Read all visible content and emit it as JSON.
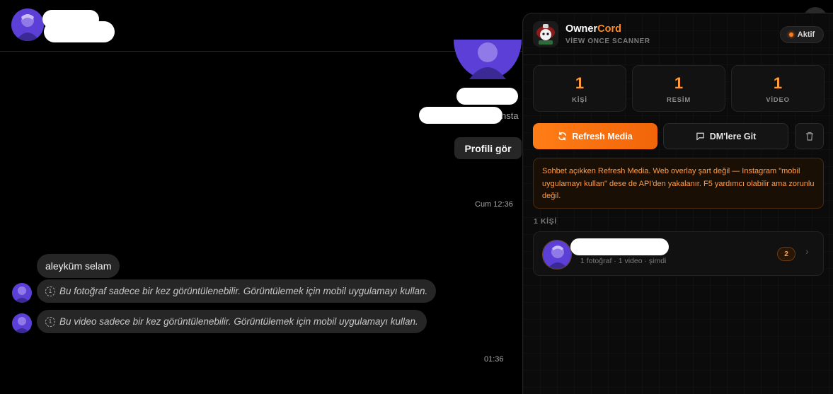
{
  "chat": {
    "profile_button": "Profili gör",
    "insta_fragment": "nsta",
    "timestamp_1": "Cum 12:36",
    "timestamp_2": "01:36",
    "messages": [
      {
        "text": "aleyküm selam"
      },
      {
        "text": "Bu fotoğraf sadece bir kez görüntülenebilir. Görüntülemek için mobil uygulamayı kullan.",
        "icon": "view-once-icon"
      },
      {
        "text": "Bu video sadece bir kez görüntülenebilir. Görüntülemek için mobil uygulamayı kullan.",
        "icon": "view-once-icon"
      }
    ]
  },
  "panel": {
    "brand_part1": "Owner",
    "brand_part2": "Cord",
    "subtitle": "VİEW ONCE SCANNER",
    "status": "Aktif",
    "stats": [
      {
        "value": "1",
        "label": "KİŞİ"
      },
      {
        "value": "1",
        "label": "RESİM"
      },
      {
        "value": "1",
        "label": "VİDEO"
      }
    ],
    "refresh_label": "Refresh Media",
    "dm_label": "DM'lere Git",
    "info": "Sohbet açıkken Refresh Media. Web overlay şart değil — Instagram \"mobil uygulamayı kullan\" dese de API'den yakalanır. F5 yardımcı olabilir ama zorunlu değil.",
    "section_label": "1 KİŞİ",
    "person": {
      "meta": "1 fotoğraf · 1 video · şimdi",
      "count": "2"
    }
  },
  "colors": {
    "accent": "#ff7d16",
    "panel_bg": "#0b0b0b",
    "bubble_bg": "#262626",
    "warning_text": "#ff9f4a"
  }
}
